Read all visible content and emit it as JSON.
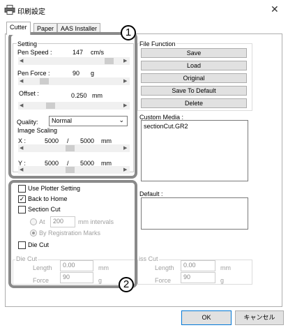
{
  "window": {
    "title": "印刷設定",
    "close_glyph": "✕",
    "icon": "printer-icon"
  },
  "tabs": [
    {
      "label": "Cutter"
    },
    {
      "label": "Paper"
    },
    {
      "label": "AAS Installer"
    }
  ],
  "setting": {
    "group_label": "Setting",
    "pen_speed_label": "Pen Speed :",
    "pen_speed_value": "147",
    "pen_speed_unit": "cm/s",
    "pen_force_label": "Pen Force :",
    "pen_force_value": "90",
    "pen_force_unit": "g",
    "offset_label": "Offset :",
    "offset_value": "0.250",
    "offset_unit": "mm",
    "quality_label": "Quality:",
    "quality_value": "Normal"
  },
  "image_scaling": {
    "group_label": "Image Scaling",
    "x_label": "X :",
    "x_value": "5000",
    "x_sep": "/",
    "x_total": "5000",
    "x_unit": "mm",
    "y_label": "Y :",
    "y_value": "5000",
    "y_sep": "/",
    "y_total": "5000",
    "y_unit": "mm"
  },
  "options": {
    "use_plotter_setting": {
      "label": "Use Plotter Setting",
      "checked": false
    },
    "back_to_home": {
      "label": "Back to Home",
      "checked": true
    },
    "section_cut": {
      "label": "Section Cut",
      "checked": false
    },
    "at_label": "At",
    "at_value": "200",
    "mm_intervals": "mm intervals",
    "by_registration_marks": "By Registration Marks",
    "die_cut": {
      "label": "Die Cut",
      "checked": false
    }
  },
  "die_cut_group": {
    "group_label": "Die Cut",
    "length_label": "Length",
    "length_value": "0.00",
    "length_unit": "mm",
    "force_label": "Force",
    "force_value": "90",
    "force_unit": "g"
  },
  "kiss_cut_group": {
    "group_label": "iss Cut",
    "length_label": "Length",
    "length_value": "0.00",
    "length_unit": "mm",
    "force_label": "Force",
    "force_value": "90",
    "force_unit": "g"
  },
  "file_function": {
    "group_label": "File Function",
    "save": "Save",
    "load": "Load",
    "original": "Original",
    "save_to_default": "Save To Default",
    "delete": "Delete"
  },
  "custom_media": {
    "label": "Custom Media :",
    "items": [
      "sectionCut.GR2"
    ]
  },
  "default_label": "Default :",
  "annotations": {
    "one": "1",
    "two": "2"
  },
  "footer": {
    "ok": "OK",
    "cancel": "キャンセル"
  },
  "colors": {
    "annotation_border": "#8a8a8a",
    "focus_blue": "#0078d7"
  }
}
